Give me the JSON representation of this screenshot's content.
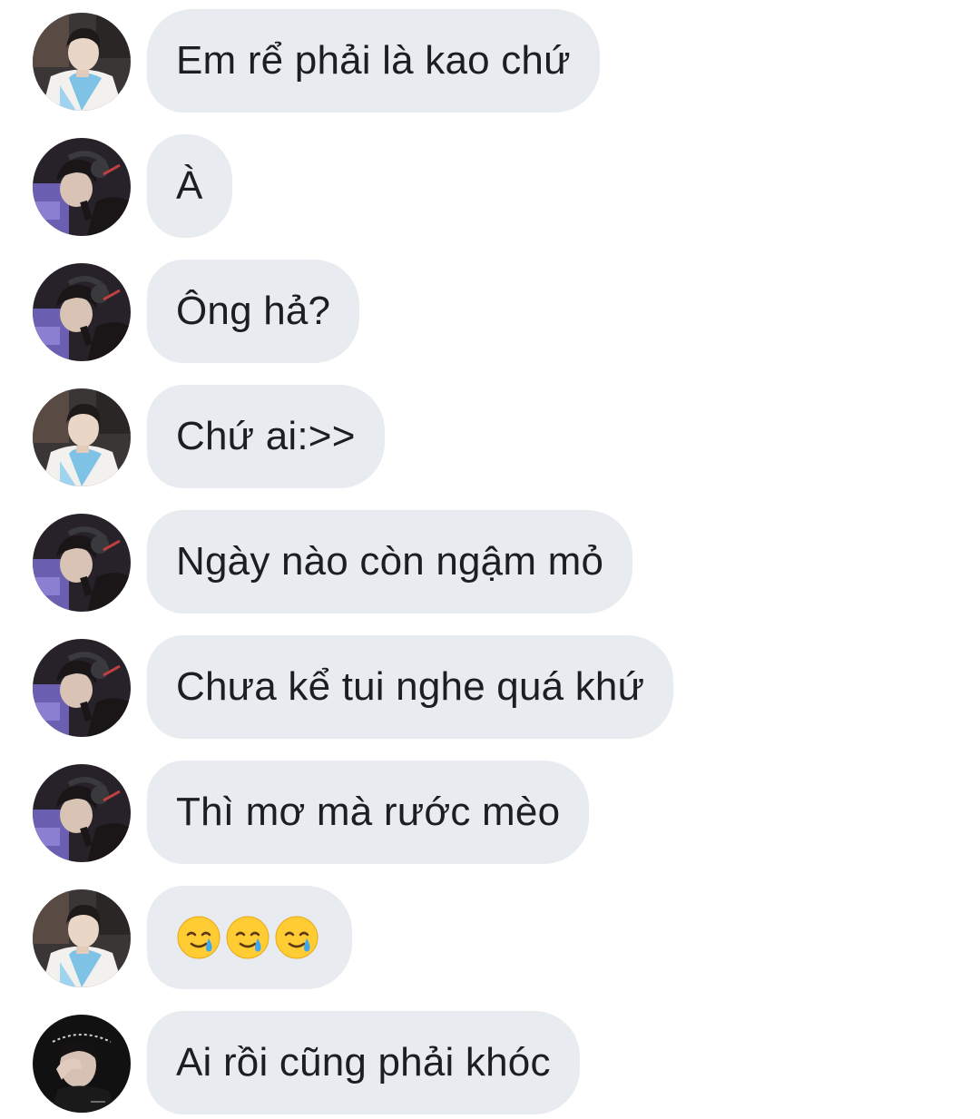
{
  "messages": [
    {
      "sender": "hanbok",
      "text": "Em rể phải là kao chứ"
    },
    {
      "sender": "headset",
      "text": "À"
    },
    {
      "sender": "headset",
      "text": "Ông hả?"
    },
    {
      "sender": "hanbok",
      "text": "Chứ ai:>>"
    },
    {
      "sender": "headset",
      "text": "Ngày nào còn ngậm mỏ"
    },
    {
      "sender": "headset",
      "text": "Chưa kể tui nghe quá khứ"
    },
    {
      "sender": "headset",
      "text": "Thì mơ mà rước mèo"
    },
    {
      "sender": "hanbok",
      "emoji": [
        "smiling-face-with-tear",
        "smiling-face-with-tear",
        "smiling-face-with-tear"
      ]
    },
    {
      "sender": "dark",
      "text": "Ai rồi cũng phải khóc"
    }
  ],
  "colors": {
    "bubble": "#e8ebef",
    "text": "#1c1e21",
    "background": "#ffffff"
  }
}
